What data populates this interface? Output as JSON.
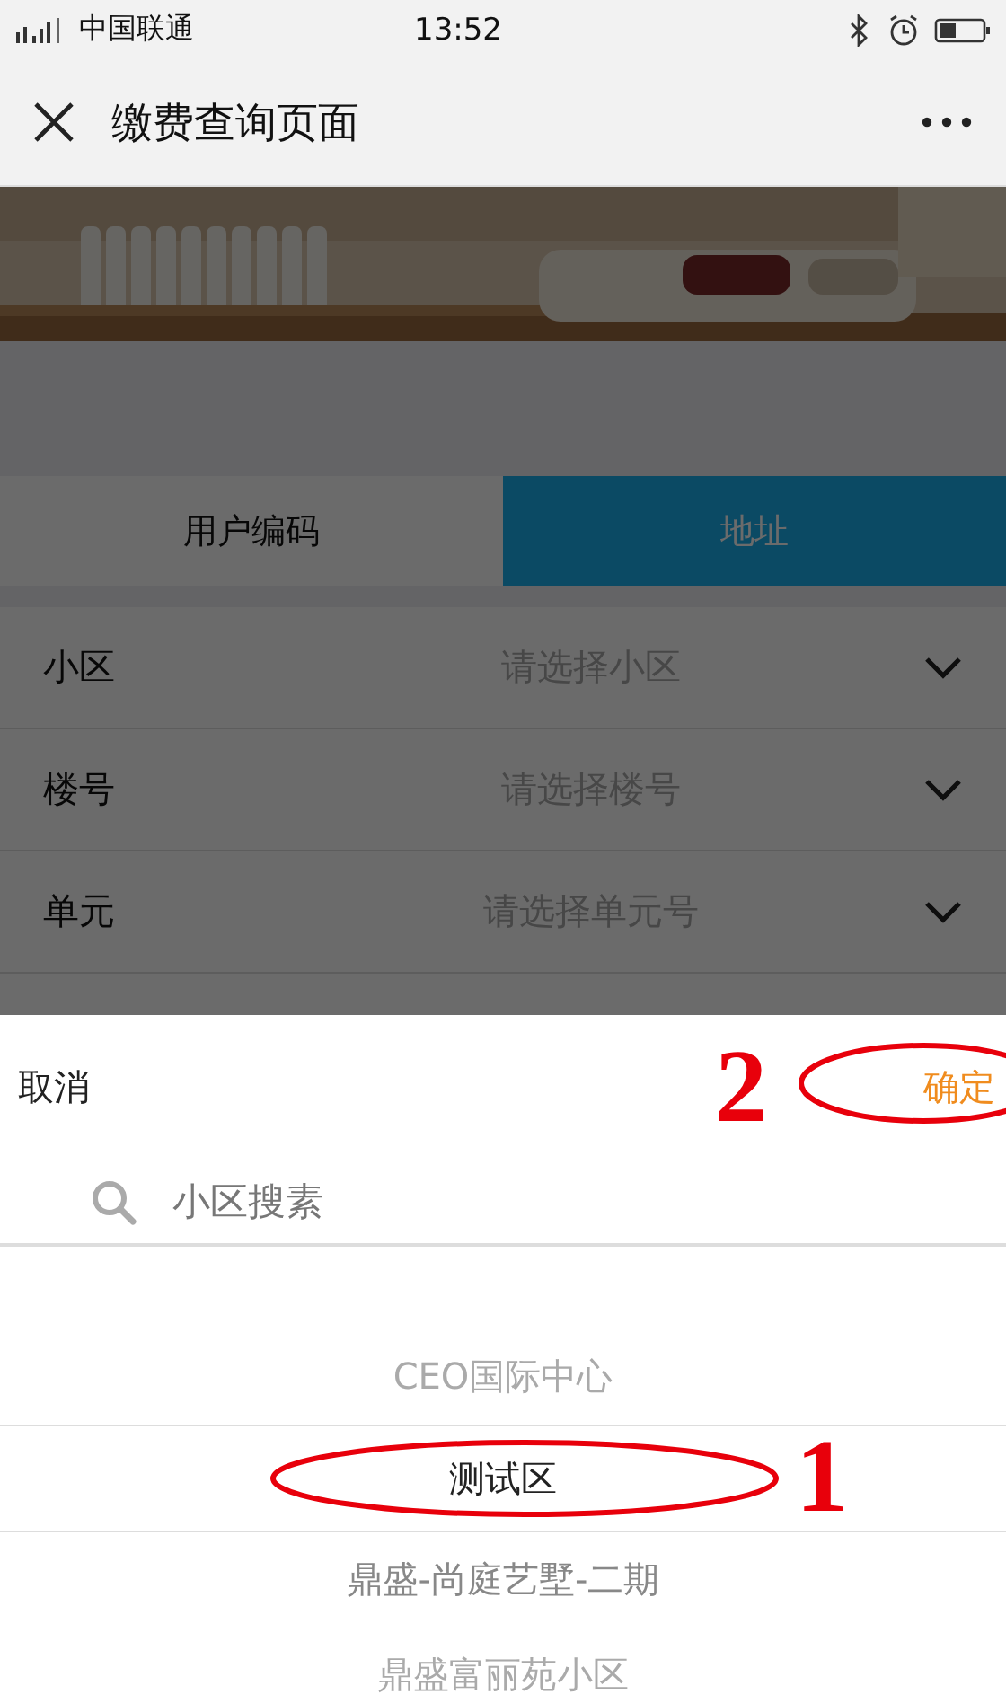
{
  "status_bar": {
    "carrier": "中国联通",
    "time": "13:52"
  },
  "nav": {
    "title": "缴费查询页面"
  },
  "tabs": [
    {
      "label": "用户编码",
      "selected": false
    },
    {
      "label": "地址",
      "selected": true
    }
  ],
  "form_rows": [
    {
      "label": "小区",
      "placeholder": "请选择小区"
    },
    {
      "label": "楼号",
      "placeholder": "请选择楼号"
    },
    {
      "label": "单元",
      "placeholder": "请选择单元号"
    }
  ],
  "picker": {
    "cancel": "取消",
    "confirm": "确定",
    "confirm_annotation": "2",
    "search_placeholder": "小区搜素",
    "options": [
      {
        "label": "CEO国际中心",
        "selected": false
      },
      {
        "label": "测试区",
        "selected": true,
        "annotation": "1"
      },
      {
        "label": "鼎盛-尚庭艺墅-二期",
        "selected": false
      },
      {
        "label": "鼎盛富丽苑小区",
        "selected": false
      }
    ]
  }
}
